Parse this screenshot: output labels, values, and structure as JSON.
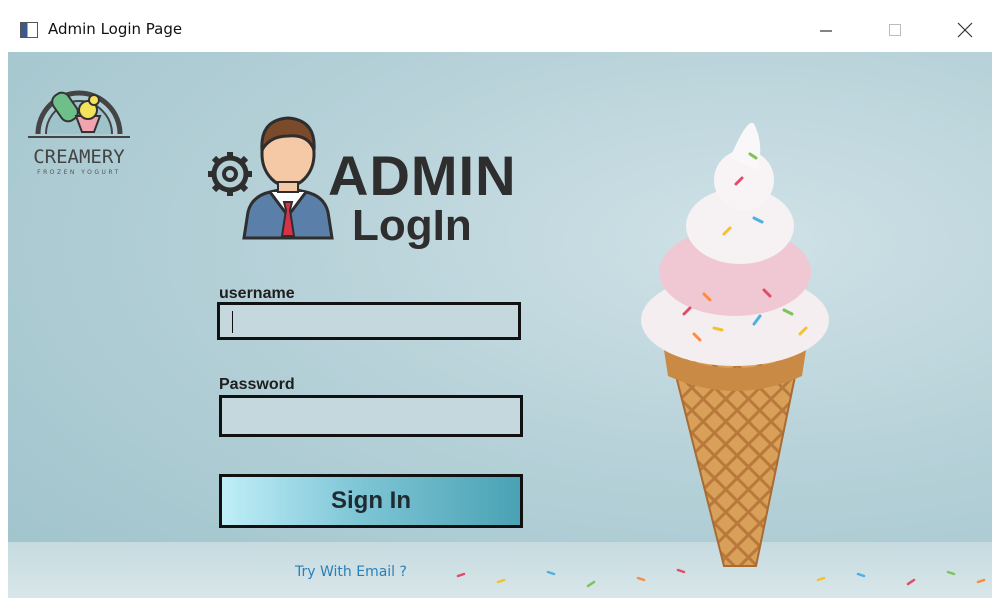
{
  "window": {
    "title": "Admin Login Page",
    "icon": "app-window-icon",
    "controls": [
      "minimize-icon",
      "maximize-icon",
      "close-icon"
    ]
  },
  "logo": {
    "name": "CREAMERY",
    "tagline": "FROZEN YOGURT"
  },
  "header": {
    "title": "ADMIN",
    "subtitle": "LogIn",
    "icons": [
      "gear-icon",
      "admin-avatar-icon"
    ]
  },
  "form": {
    "username_label": "username",
    "username_value": "",
    "password_label": "Password",
    "password_value": "",
    "submit_label": "Sign In",
    "alt_link": "Try With Email ?"
  },
  "colors": {
    "background": "#b6d1d8",
    "field_fill": "#c4d8dd",
    "button_gradient_start": "#bfeef8",
    "button_gradient_end": "#4aa2b4",
    "link": "#2a7fb8",
    "title_text": "#2e2e2e"
  }
}
